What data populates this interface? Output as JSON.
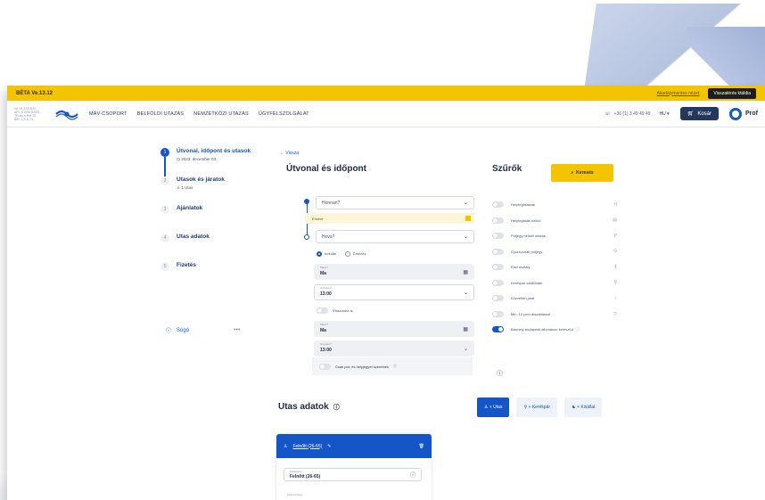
{
  "topbar": {
    "version": "BÉTA Ve.13.12",
    "contrast": "Akadálymentes nézet",
    "old_site": "Visszatérés ktáldia"
  },
  "system_info": [
    "Ve.1S.2SS.S2S",
    "API: S.2OS.SSSS",
    "TD.ke: v.Pdf.7S",
    "BIE: L.S.S.75"
  ],
  "nav": {
    "menu": [
      "MÁV-CSOPORT",
      "BELFÖLDI UTAZÁS",
      "NEMZETKÖZI UTAZÁS",
      "ÜGYFÉLSZOLGÁLAT"
    ],
    "phone": "+36 (1) 3 49 49 49",
    "lang": "HU",
    "cart": "Kosár",
    "profile": "Prof"
  },
  "steps": [
    {
      "num": "1",
      "title": "Útvonal, időpont és utasok",
      "sub": "2023. december 03.",
      "sub_icon": "clock-icon"
    },
    {
      "num": "2",
      "title": "Utasok és járatok",
      "sub": "1 Utas",
      "sub_icon": "person-icon"
    },
    {
      "num": "3",
      "title": "Ajánlatok",
      "sub": ""
    },
    {
      "num": "4",
      "title": "Utas adatok",
      "sub": ""
    },
    {
      "num": "5",
      "title": "Fizetés",
      "sub": ""
    }
  ],
  "help": {
    "label": "Súgó",
    "more": "•••"
  },
  "route": {
    "back": "Vissza",
    "title": "Útvonal és időpont",
    "from_placeholder": "Honnan?",
    "via": "Érintve",
    "to_placeholder": "Hova?",
    "radio_depart": "Indulás",
    "radio_arrive": "Érkezés",
    "date_label": "Mikor?",
    "date_value": "Ma",
    "time_label": "Hánykor?",
    "time_value": "13:00",
    "return_toggle": "Visszaútra is",
    "ret_date_label": "Mikor?",
    "ret_date_value": "Ma",
    "ret_time_label": "Hánykor?",
    "ret_time_value": "13:00",
    "seat_only": "Csak pót- és helyjegyet szeretnék"
  },
  "filters": {
    "title": "Szűrők",
    "search_button": "Keresés",
    "items": [
      {
        "label": "Helyfoglalással",
        "on": false,
        "icon": "H"
      },
      {
        "label": "Helyfoglalás nélkül",
        "on": false,
        "icon": "▤"
      },
      {
        "label": "Pótjegy nélküli utazás",
        "on": false,
        "icon": "P"
      },
      {
        "label": "Gyorsvonati pótjegy",
        "on": false,
        "icon": "G"
      },
      {
        "label": "Első osztály",
        "on": false,
        "icon": "1"
      },
      {
        "label": "Kerékpár szállítható",
        "on": false,
        "icon": "⚲"
      },
      {
        "label": "Közvetlen járat",
        "on": false,
        "icon": "↕"
      },
      {
        "label": "Min. 10 perc átszállással",
        "on": false,
        "icon": "◷"
      },
      {
        "label": "Bármely budapesti állomáson keresztül",
        "on": true,
        "icon": "ⓘ"
      }
    ]
  },
  "passengers": {
    "title": "Utas adatok",
    "add_passenger": "+ Utas",
    "add_bike": "+ Kerékpár",
    "add_pet": "+ Kisállat",
    "card_name": "Felnőtt (26-65)",
    "type_label": "Utastípus*",
    "type_value": "Felnőtt (26-65)",
    "extra_label": "Kedvezmény"
  },
  "colors": {
    "brand_yellow": "#f5c400",
    "brand_blue": "#1456c8",
    "navy": "#24385d"
  }
}
